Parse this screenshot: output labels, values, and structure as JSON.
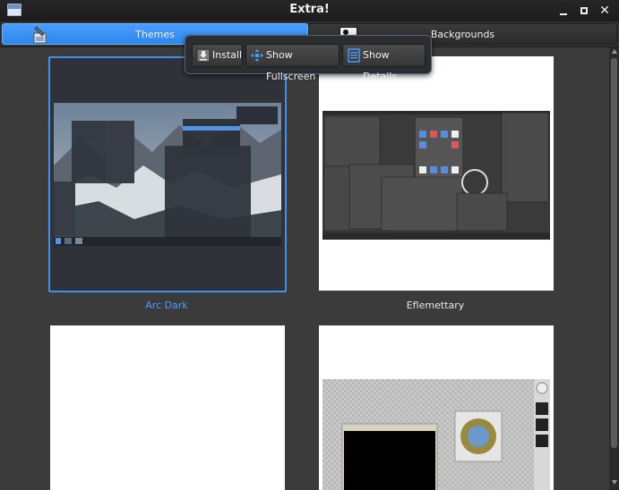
{
  "window": {
    "title": "Extra!"
  },
  "tabs": [
    {
      "label": "Themes",
      "active": true
    },
    {
      "label": "Backgrounds",
      "active": false
    }
  ],
  "toolbar": {
    "install_label": "Install",
    "fullscreen_label": "Show Fullscreen",
    "details_label": "Show Details"
  },
  "themes": [
    {
      "name": "Arc Dark",
      "selected": true
    },
    {
      "name": "Eflemettary",
      "selected": false
    },
    {
      "name": "",
      "selected": false
    },
    {
      "name": "",
      "selected": false
    }
  ],
  "colors": {
    "accent": "#3f90f0",
    "background": "#3b3b3b",
    "titlebar": "#1c1c1c"
  }
}
